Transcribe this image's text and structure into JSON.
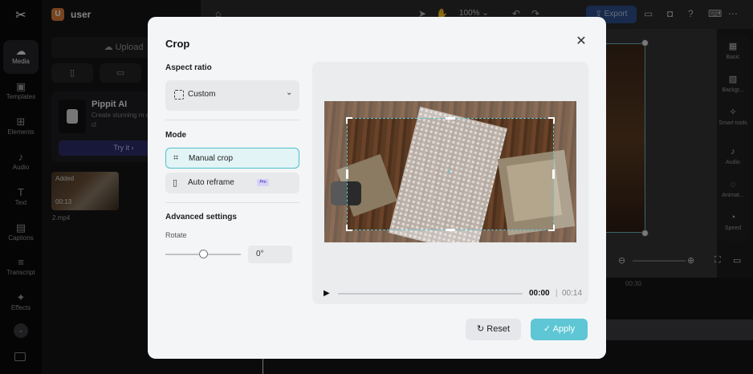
{
  "app": {
    "logo": "✂",
    "user_initial": "U",
    "user_name": "user"
  },
  "rail": {
    "items": [
      {
        "label": "Media",
        "icon": "cloud-icon"
      },
      {
        "label": "Templates",
        "icon": "templates-icon"
      },
      {
        "label": "Elements",
        "icon": "elements-icon"
      },
      {
        "label": "Audio",
        "icon": "music-icon"
      },
      {
        "label": "Text",
        "icon": "text-icon"
      },
      {
        "label": "Captions",
        "icon": "captions-icon"
      },
      {
        "label": "Transcript",
        "icon": "transcript-icon"
      },
      {
        "label": "Effects",
        "icon": "effects-icon"
      }
    ]
  },
  "panel": {
    "upload_label": "Upload",
    "ai_card": {
      "title": "Pippit AI",
      "desc": "Create stunning m content in a few cl",
      "try_label": "Try it"
    },
    "media": {
      "added": "Added",
      "duration": "00:13",
      "filename": "2.mp4"
    }
  },
  "topbar": {
    "zoom": "100%",
    "export_label": "Export"
  },
  "tools": [
    {
      "label": "Basic",
      "icon": "film-icon"
    },
    {
      "label": "Backgr...",
      "icon": "background-icon"
    },
    {
      "label": "Smart tools",
      "icon": "magic-wand-icon"
    },
    {
      "label": "Audio",
      "icon": "music-icon"
    },
    {
      "label": "Animat...",
      "icon": "animation-icon"
    },
    {
      "label": "Speed",
      "icon": "speed-icon"
    }
  ],
  "timeline": {
    "tick": "00:30"
  },
  "modal": {
    "title": "Crop",
    "aspect_label": "Aspect ratio",
    "aspect_value": "Custom",
    "mode_label": "Mode",
    "modes": [
      {
        "label": "Manual crop",
        "selected": true
      },
      {
        "label": "Auto reframe",
        "selected": false,
        "badge": "Pro"
      }
    ],
    "advanced_label": "Advanced settings",
    "rotate_label": "Rotate",
    "rotate_value": "0°",
    "player": {
      "current": "00:00",
      "separator": "|",
      "total": "00:14"
    },
    "reset_label": "Reset",
    "apply_label": "Apply"
  },
  "colors": {
    "accent": "#5ec6d4",
    "crop_border": "#63c5d2"
  }
}
